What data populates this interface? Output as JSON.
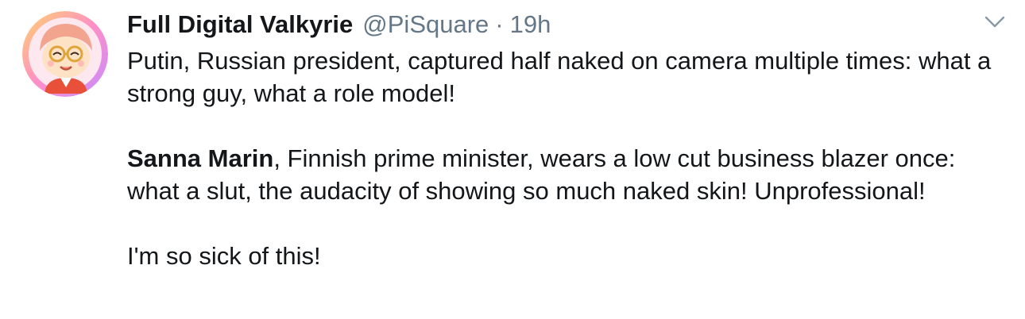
{
  "tweet": {
    "author": {
      "display_name": "Full Digital Valkyrie",
      "handle": "@PiSquare",
      "avatar_icon": "cartoon-character-avatar"
    },
    "separator": "·",
    "timestamp": "19h",
    "menu_icon": "chevron-down-icon",
    "text": {
      "p1": "Putin, Russian president, captured half naked on camera multiple times: what a strong guy, what a role model!",
      "p2_bold": "Sanna Marin",
      "p2_rest": ", Finnish prime minister, wears a low cut business blazer once: what a slut, the audacity of showing so much naked skin! Unprofessional!",
      "p3": "I'm so sick of this!"
    }
  },
  "colors": {
    "text_primary": "#14171a",
    "text_secondary": "#657786",
    "avatar_ring": "#f5a3c7"
  }
}
